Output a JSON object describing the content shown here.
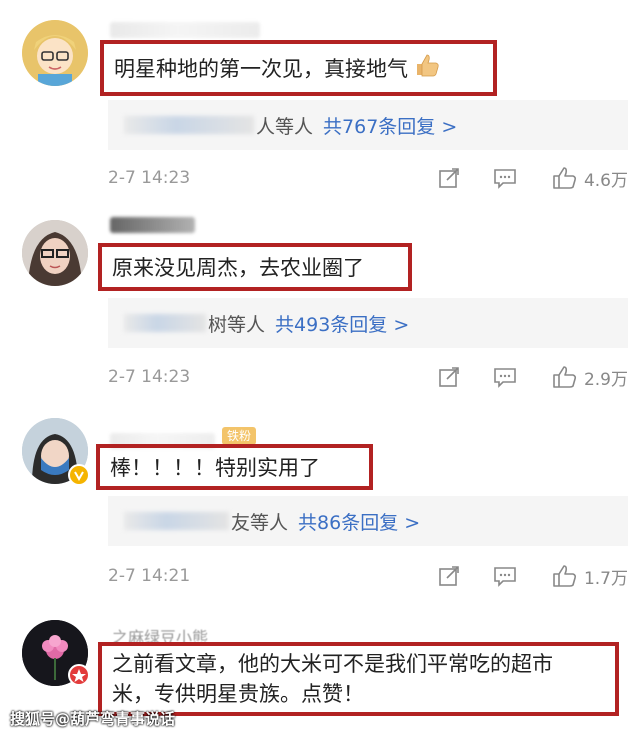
{
  "comments": [
    {
      "text": "明星种地的第一次见，真接地气",
      "reply_partial": "人等人",
      "reply_count": "共767条回复 >",
      "time": "2-7 14:23",
      "likes": "4.6万"
    },
    {
      "text": "原来没见周杰，去农业圈了",
      "reply_partial": "树等人",
      "reply_count": "共493条回复 >",
      "time": "2-7 14:23",
      "likes": "2.9万"
    },
    {
      "badge": "铁粉",
      "text": "棒！！！！特别实用了",
      "reply_partial": "友等人",
      "reply_count": "共86条回复 >",
      "time": "2-7 14:21",
      "likes": "1.7万"
    },
    {
      "name_partial": "之麻绿豆小熊",
      "text_line1": "之前看文章，他的大米可不是我们平常吃的超市",
      "text_line2": "米，专供明星贵族。点赞！"
    }
  ],
  "watermark": "搜狐号@葫芦弯青事说话",
  "colors": {
    "highlight_border": "#b22222",
    "reply_link": "#3b6fc4",
    "reply_bg": "#f5f5f5"
  },
  "icons": [
    "share-icon",
    "comment-icon",
    "thumbs-up-icon",
    "thumbs-up-emoji",
    "verified-badge-icon"
  ]
}
